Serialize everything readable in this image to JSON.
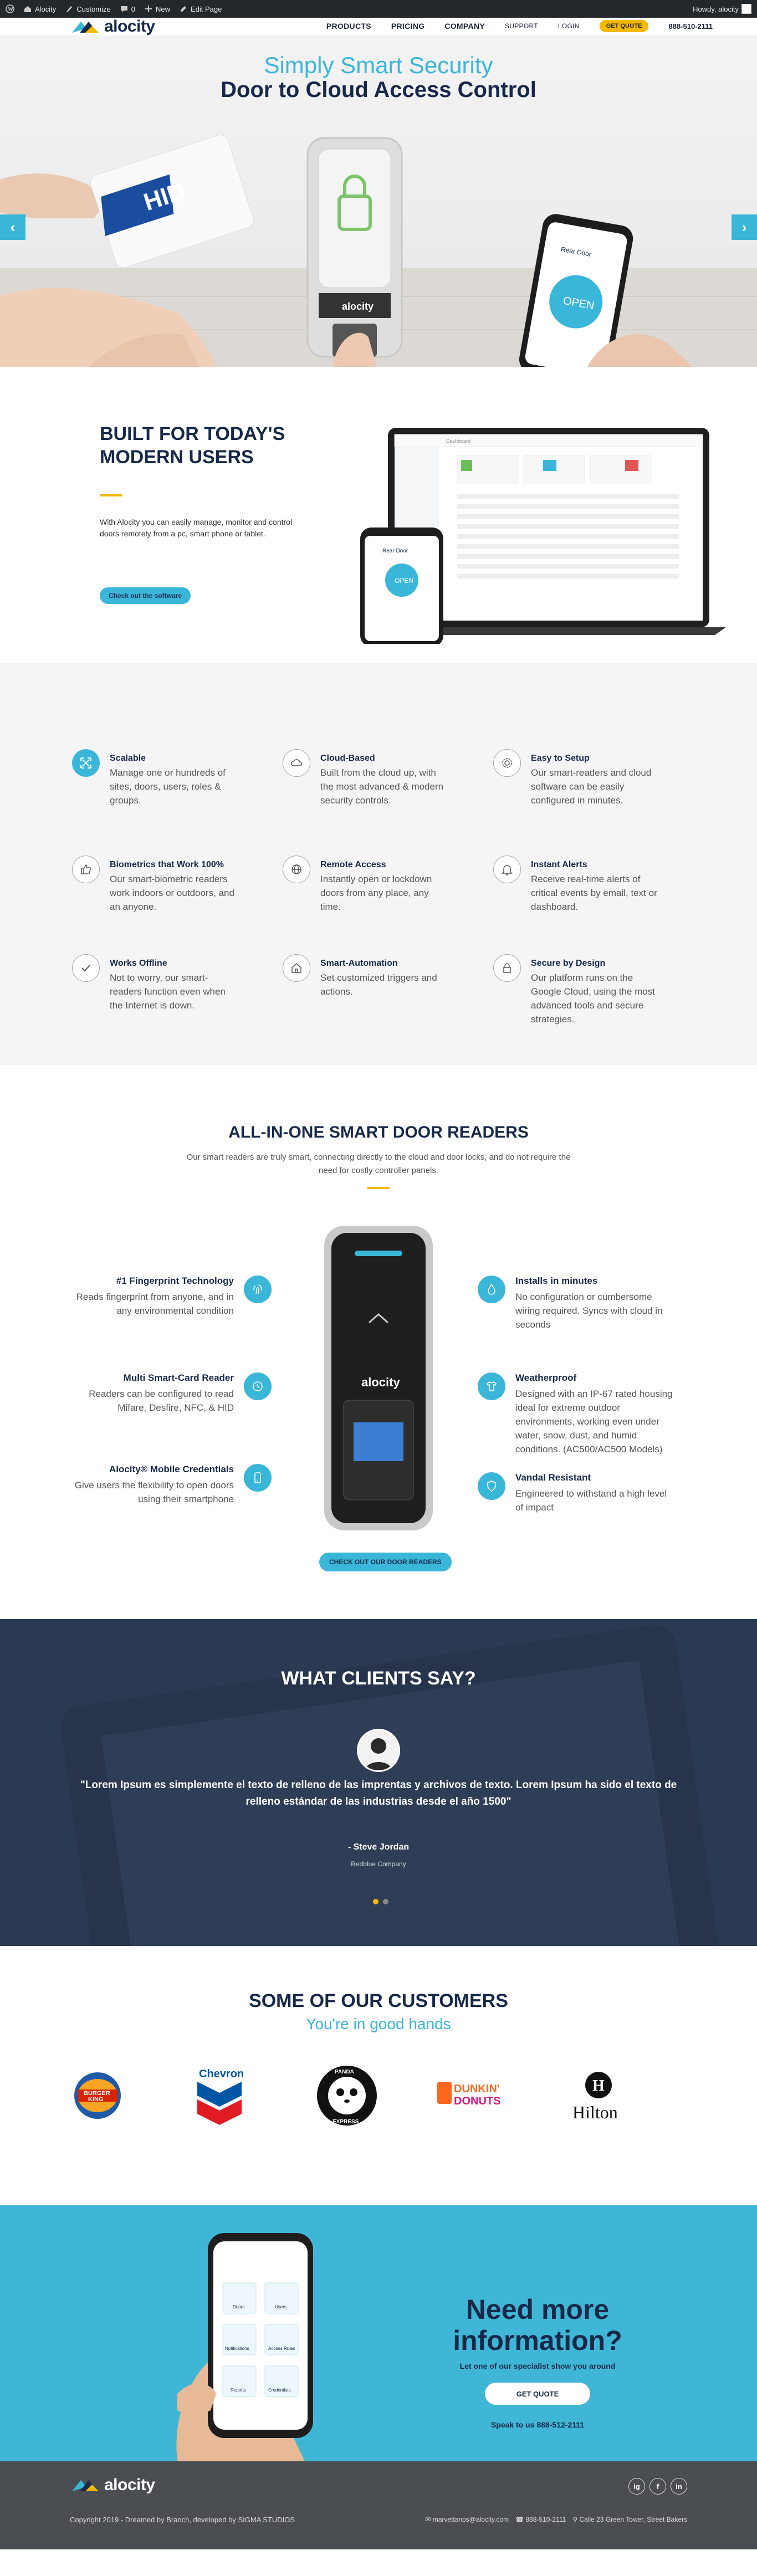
{
  "admin_bar": {
    "site_name": "Alocity",
    "customize": "Customize",
    "comments_count": "0",
    "new_label": "New",
    "edit_page": "Edit Page",
    "howdy": "Howdy, alocity"
  },
  "header": {
    "logo_text": "alocity",
    "nav": [
      "PRODUCTS",
      "PRICING",
      "COMPANY"
    ],
    "support": "SUPPORT",
    "login": "LOGIN",
    "quote": "GET QUOTE",
    "phone": "888-510-2111"
  },
  "hero": {
    "title": "Simply Smart Security",
    "subtitle": "Door to Cloud Access Control",
    "card_brand": "HID",
    "reader_brand": "alocity",
    "phone_header": "Rear Door",
    "phone_button": "OPEN",
    "colors": {
      "accent": "#3ab6d9",
      "navy": "#17294a"
    }
  },
  "built": {
    "title": "BUILT FOR TODAY'S MODERN USERS",
    "text": "With Alocity you can easily manage, monitor and control doors remotely from a pc, smart phone or tablet.",
    "button": "Check out the software",
    "laptop_header": "Dashboard",
    "phone_header": "Rear Door",
    "phone_button": "OPEN"
  },
  "features": [
    {
      "title": "Scalable",
      "desc": "Manage one or hundreds of sites, doors, users, roles & groups.",
      "icon": "expand-icon",
      "filled": true
    },
    {
      "title": "Cloud-Based",
      "desc": "Built from the cloud up, with the most advanced & modern security controls.",
      "icon": "cloud-icon",
      "filled": false
    },
    {
      "title": "Easy to Setup",
      "desc": "Our smart-readers and cloud software can be easily configured in minutes.",
      "icon": "gear-icon",
      "filled": false
    },
    {
      "title": "Biometrics that Work 100%",
      "desc": "Our smart-biometric readers work indoors or outdoors, and an anyone.",
      "icon": "thumbs-up-icon",
      "filled": false
    },
    {
      "title": "Remote Access",
      "desc": "Instantly open or lockdown doors from any place, any time.",
      "icon": "globe-icon",
      "filled": false
    },
    {
      "title": "Instant Alerts",
      "desc": "Receive real-time alerts of critical events by email, text or dashboard.",
      "icon": "bell-icon",
      "filled": false
    },
    {
      "title": "Works Offline",
      "desc": "Not to worry, our smart-readers function even when the Internet is down.",
      "icon": "check-icon",
      "filled": false
    },
    {
      "title": "Smart-Automation",
      "desc": "Set customized triggers and actions.",
      "icon": "home-icon",
      "filled": false
    },
    {
      "title": "Secure by Design",
      "desc": "Our platform runs on the Google Cloud, using the most advanced tools and secure strategies.",
      "icon": "lock-icon",
      "filled": false
    }
  ],
  "readers": {
    "title": "ALL-IN-ONE SMART DOOR READERS",
    "subtitle": "Our smart readers are truly smart, connecting directly to the cloud and door locks, and do not require the need for costly controller panels.",
    "left": [
      {
        "title": "#1 Fingerprint Technology",
        "desc": "Reads fingerprint from anyone, and in any environmental condition",
        "icon": "fingerprint-icon"
      },
      {
        "title": "Multi Smart-Card Reader",
        "desc": "Readers can be configured to read Mifare, Desfire, NFC, & HID",
        "icon": "card-reader-icon"
      },
      {
        "title": "Alocity® Mobile Credentials",
        "desc": "Give users the flexibility to open doors using their smartphone",
        "icon": "mobile-icon"
      }
    ],
    "right": [
      {
        "title": "Installs in minutes",
        "desc": "No configuration or cumbersome wiring required. Syncs with cloud in seconds",
        "icon": "water-drop-icon"
      },
      {
        "title": "Weatherproof",
        "desc": "Designed with an IP-67 rated housing ideal for extreme outdoor environments, working even under water, snow, dust, and humid conditions. (AC500/AC500 Models)",
        "icon": "shirt-icon"
      },
      {
        "title": "Vandal Resistant",
        "desc": "Engineered to withstand a high level of impact",
        "icon": "shield-icon"
      }
    ],
    "device_brand": "alocity",
    "button": "CHECK OUT OUR DOOR READERS"
  },
  "testimonials": {
    "title": "WHAT CLIENTS SAY?",
    "quote": "\"Lorem Ipsum es simplemente el texto de relleno de las imprentas y archivos de texto. Lorem Ipsum ha sido el texto de relleno estándar de las industrias desde el año 1500\"",
    "name": "- Steve Jordan",
    "company": "Redbluе Company"
  },
  "customers": {
    "title": "SOME OF OUR CUSTOMERS",
    "subtitle": "You're in good hands",
    "logos": {
      "burger_king": [
        "BURGER",
        "KING"
      ],
      "chevron": "Chevron",
      "panda": [
        "PANDA",
        "EXPRESS"
      ],
      "dunkin": [
        "DUNKIN'",
        "DONUTS"
      ],
      "hilton": "Hilton"
    }
  },
  "needinfo": {
    "title": "Need more information?",
    "subtitle": "Let one of our specialist show you around",
    "button": "GET QUOTE",
    "phone": "Speak to us 888-512-2111",
    "phone_tiles": [
      "Doors",
      "Users",
      "Notifications",
      "Access Rules",
      "Reports",
      "Credentials"
    ]
  },
  "footer": {
    "logo_text": "alocity",
    "copyright": "Copyright 2019 - Dreamed by Branch, developed by SIGMA STUDIOS",
    "email": "marvettanos@alocity.com",
    "phone": "888-510-2111",
    "address": "Calle 23 Green Tower, Street Bakers",
    "social": [
      "ig",
      "f",
      "in"
    ]
  }
}
